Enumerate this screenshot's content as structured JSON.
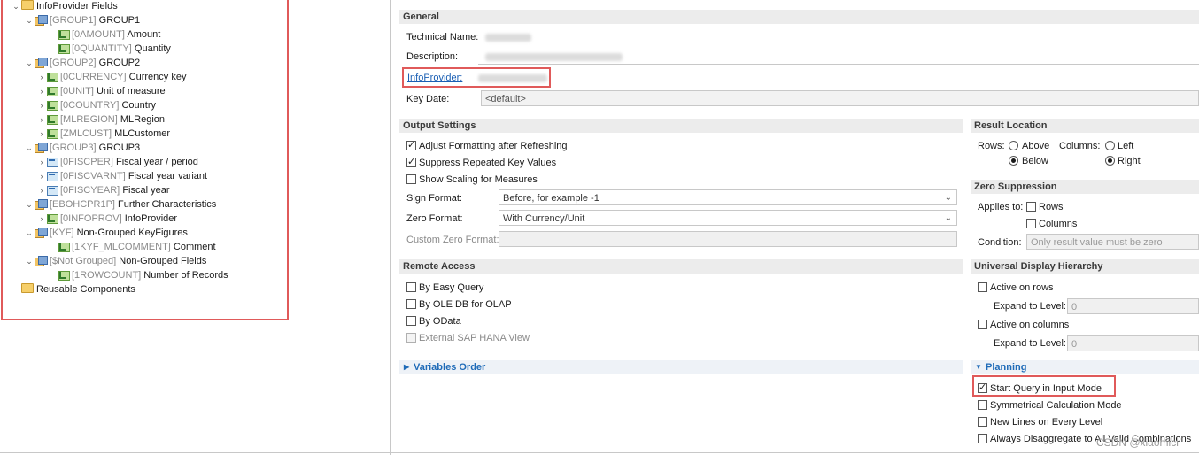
{
  "tree": {
    "rows": [
      {
        "tw": "⌄",
        "icon": "folder",
        "tech": "",
        "name": "InfoProvider Fields",
        "indent": 0
      },
      {
        "tw": "⌄",
        "icon": "group",
        "tech": "[GROUP1]",
        "name": "GROUP1",
        "indent": 1
      },
      {
        "tw": "",
        "icon": "kf",
        "tech": "[0AMOUNT]",
        "name": "Amount",
        "indent": 3
      },
      {
        "tw": "",
        "icon": "kf",
        "tech": "[0QUANTITY]",
        "name": "Quantity",
        "indent": 3
      },
      {
        "tw": "⌄",
        "icon": "group",
        "tech": "[GROUP2]",
        "name": "GROUP2",
        "indent": 1
      },
      {
        "tw": "›",
        "icon": "kf",
        "tech": "[0CURRENCY]",
        "name": "Currency key",
        "indent": 2
      },
      {
        "tw": "›",
        "icon": "kf",
        "tech": "[0UNIT]",
        "name": "Unit of measure",
        "indent": 2
      },
      {
        "tw": "›",
        "icon": "kf",
        "tech": "[0COUNTRY]",
        "name": "Country",
        "indent": 2
      },
      {
        "tw": "›",
        "icon": "kf",
        "tech": "[MLREGION]",
        "name": "MLRegion",
        "indent": 2
      },
      {
        "tw": "›",
        "icon": "kf",
        "tech": "[ZMLCUST]",
        "name": "MLCustomer",
        "indent": 2
      },
      {
        "tw": "⌄",
        "icon": "group",
        "tech": "[GROUP3]",
        "name": "GROUP3",
        "indent": 1
      },
      {
        "tw": "›",
        "icon": "char",
        "tech": "[0FISCPER]",
        "name": "Fiscal year / period",
        "indent": 2
      },
      {
        "tw": "›",
        "icon": "char",
        "tech": "[0FISCVARNT]",
        "name": "Fiscal year variant",
        "indent": 2
      },
      {
        "tw": "›",
        "icon": "char",
        "tech": "[0FISCYEAR]",
        "name": "Fiscal year",
        "indent": 2
      },
      {
        "tw": "⌄",
        "icon": "group",
        "tech": "[EBOHCPR1P]",
        "name": "Further Characteristics",
        "indent": 1
      },
      {
        "tw": "›",
        "icon": "kf",
        "tech": "[0INFOPROV]",
        "name": "InfoProvider",
        "indent": 2
      },
      {
        "tw": "⌄",
        "icon": "group",
        "tech": "[KYF]",
        "name": "Non-Grouped KeyFigures",
        "indent": 1
      },
      {
        "tw": "",
        "icon": "kf",
        "tech": "[1KYF_MLCOMMENT]",
        "name": "Comment",
        "indent": 3
      },
      {
        "tw": "⌄",
        "icon": "group",
        "tech": "[$Not Grouped]",
        "name": "Non-Grouped Fields",
        "indent": 1
      },
      {
        "tw": "",
        "icon": "kf",
        "tech": "[1ROWCOUNT]",
        "name": "Number of Records",
        "indent": 3
      },
      {
        "tw": "",
        "icon": "folder",
        "tech": "",
        "name": "Reusable Components",
        "indent": 0
      }
    ]
  },
  "general": {
    "title": "General",
    "technical_name_label": "Technical Name:",
    "description_label": "Description:",
    "infoprovider_label": "InfoProvider:",
    "key_date_label": "Key Date:",
    "key_date_value": "<default>"
  },
  "output": {
    "title": "Output Settings",
    "adjust_formatting": "Adjust Formatting after Refreshing",
    "suppress_repeated": "Suppress Repeated Key Values",
    "show_scaling": "Show Scaling for Measures",
    "sign_format_label": "Sign Format:",
    "sign_format_value": "Before, for example -1",
    "zero_format_label": "Zero Format:",
    "zero_format_value": "With Currency/Unit",
    "custom_zero_label": "Custom Zero Format:"
  },
  "result": {
    "title": "Result Location",
    "rows_label": "Rows:",
    "above": "Above",
    "below": "Below",
    "columns_label": "Columns:",
    "left": "Left",
    "right": "Right"
  },
  "zero": {
    "title": "Zero Suppression",
    "applies_label": "Applies to:",
    "rows": "Rows",
    "columns": "Columns",
    "condition_label": "Condition:",
    "condition_placeholder": "Only result value must be zero"
  },
  "remote": {
    "title": "Remote Access",
    "easy_query": "By Easy Query",
    "ole_db": "By OLE DB for OLAP",
    "odata": "By OData",
    "hana_view": "External SAP HANA View"
  },
  "udh": {
    "title": "Universal Display Hierarchy",
    "active_rows": "Active on rows",
    "expand_label": "Expand to Level:",
    "expand_rows_value": "0",
    "active_columns": "Active on columns",
    "expand_columns_value": "0"
  },
  "variables": {
    "title": "Variables Order"
  },
  "planning": {
    "title": "Planning",
    "start_input_mode": "Start Query in Input Mode",
    "symmetrical": "Symmetrical Calculation Mode",
    "new_lines": "New Lines on Every Level",
    "always_disaggregate": "Always Disaggregate to All Valid Combinations"
  },
  "watermark": "CSDN @xiaomici",
  "colors": {
    "highlight": "#e05a5a",
    "section_bg": "#ececec",
    "link": "#1a5fb4"
  }
}
